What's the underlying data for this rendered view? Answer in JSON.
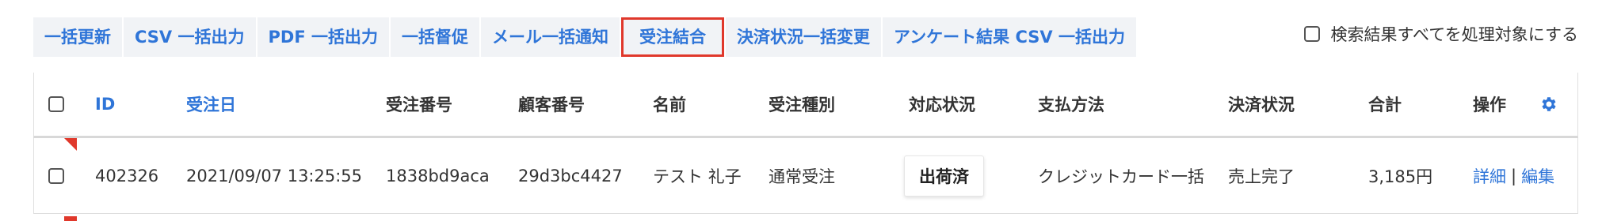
{
  "toolbar": {
    "buttons": [
      "一括更新",
      "CSV 一括出力",
      "PDF 一括出力",
      "一括督促",
      "メール一括通知",
      "受注結合",
      "決済状況一括変更",
      "アンケート結果 CSV 一括出力"
    ],
    "highlighted_index": 5
  },
  "select_all_label": "検索結果すべてを処理対象にする",
  "table": {
    "headers": {
      "id": "ID",
      "order_date": "受注日",
      "order_no": "受注番号",
      "customer_no": "顧客番号",
      "name": "名前",
      "order_type": "受注種別",
      "status": "対応状況",
      "payment_method": "支払方法",
      "payment_status": "決済状況",
      "total": "合計",
      "actions": "操作"
    },
    "rows": [
      {
        "id": "402326",
        "order_date": "2021/09/07 13:25:55",
        "order_no": "1838bd9aca",
        "customer_no": "29d3bc4427",
        "name": "テスト 礼子",
        "order_type": "通常受注",
        "status": "出荷済",
        "payment_method": "クレジットカード一括",
        "payment_status": "売上完了",
        "total": "3,185円",
        "detail": "詳細",
        "separator": "|",
        "edit": "編集"
      }
    ]
  },
  "colors": {
    "link": "#2f75d8",
    "highlight_border": "#e0382b",
    "toolbar_bg": "#f1f3f6"
  },
  "icons": {
    "settings": "gear-icon"
  }
}
